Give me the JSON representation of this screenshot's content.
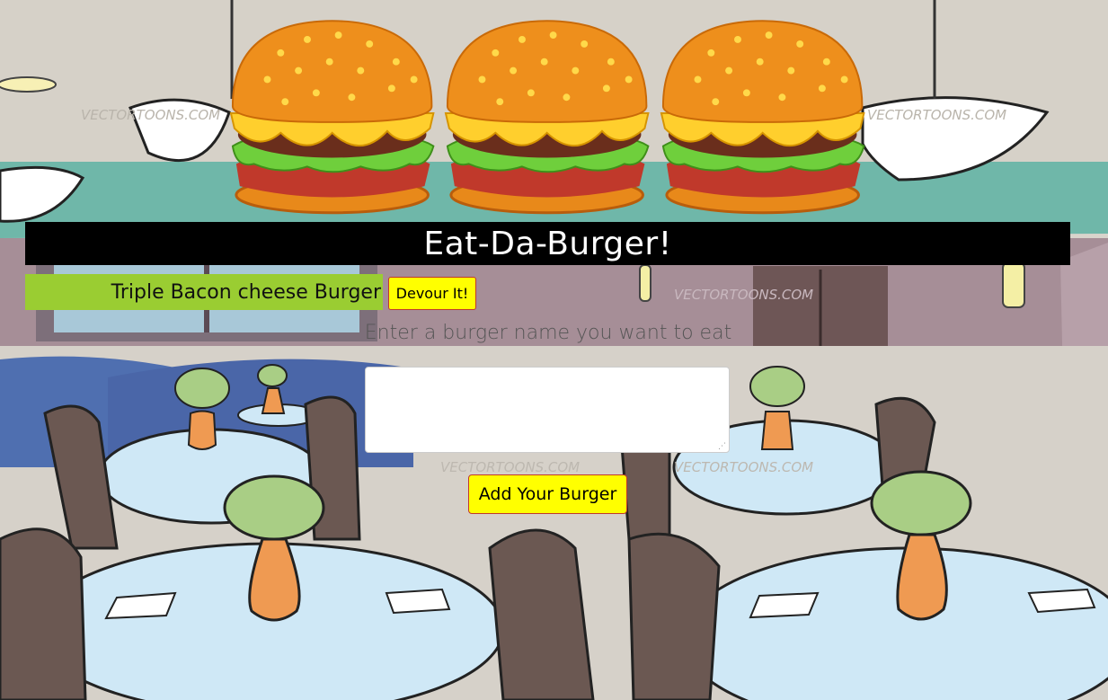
{
  "page": {
    "title": "Eat-Da-Burger!"
  },
  "burgers": [
    {
      "name": "Triple Bacon cheese Burger",
      "action_label": "Devour It!"
    }
  ],
  "form": {
    "prompt": "Enter a burger name you want to eat",
    "input_value": "",
    "submit_label": "Add Your Burger"
  },
  "background": {
    "watermark": "VECTORTOONS.COM"
  },
  "colors": {
    "header_bg": "#000000",
    "header_text": "#ffffff",
    "burger_row_bg": "#9acd32",
    "button_bg": "#ffff00",
    "button_border": "#c0392b"
  }
}
